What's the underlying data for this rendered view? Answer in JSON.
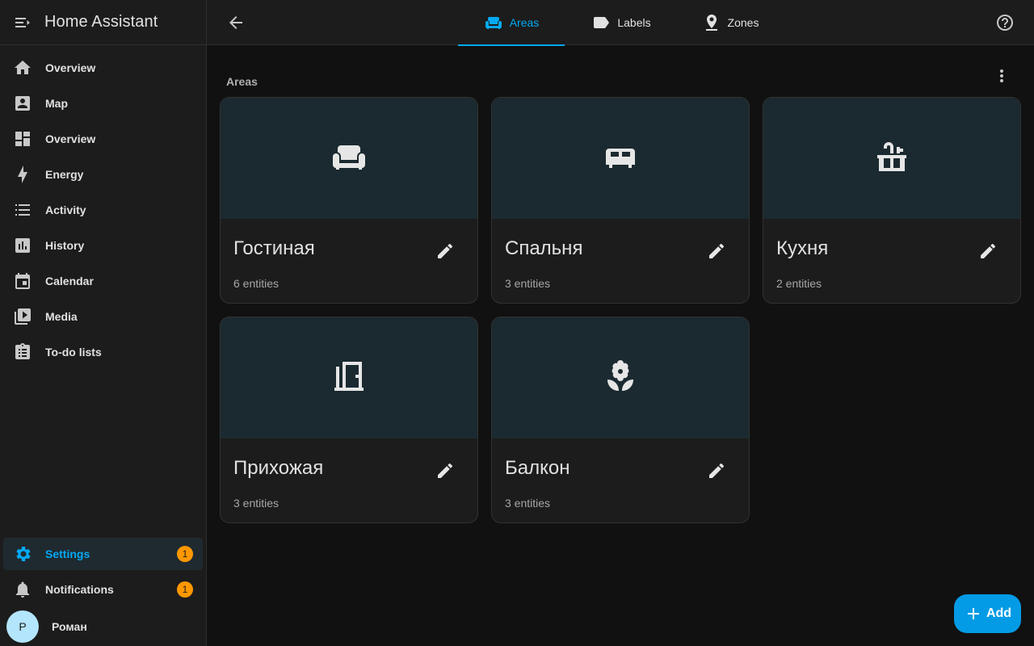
{
  "app": {
    "title": "Home Assistant"
  },
  "sidebar": {
    "items": [
      {
        "label": "Overview",
        "icon": "home-icon"
      },
      {
        "label": "Map",
        "icon": "map-icon"
      },
      {
        "label": "Overview",
        "icon": "dashboard-icon"
      },
      {
        "label": "Energy",
        "icon": "energy-icon"
      },
      {
        "label": "Activity",
        "icon": "activity-icon"
      },
      {
        "label": "History",
        "icon": "history-icon"
      },
      {
        "label": "Calendar",
        "icon": "calendar-icon"
      },
      {
        "label": "Media",
        "icon": "media-icon"
      },
      {
        "label": "To-do lists",
        "icon": "todo-icon"
      }
    ],
    "settings": {
      "label": "Settings",
      "badge": "1"
    },
    "notifications": {
      "label": "Notifications",
      "badge": "1"
    },
    "user": {
      "initial": "Р",
      "name": "Роман"
    }
  },
  "topbar": {
    "tabs": [
      {
        "label": "Areas",
        "icon": "sofa-icon",
        "active": true
      },
      {
        "label": "Labels",
        "icon": "label-icon",
        "active": false
      },
      {
        "label": "Zones",
        "icon": "map-marker-icon",
        "active": false
      }
    ]
  },
  "main": {
    "section_title": "Areas",
    "areas": [
      {
        "name": "Гостиная",
        "entities": "6 entities",
        "icon": "sofa-icon"
      },
      {
        "name": "Спальня",
        "entities": "3 entities",
        "icon": "bed-icon"
      },
      {
        "name": "Кухня",
        "entities": "2 entities",
        "icon": "sink-icon"
      },
      {
        "name": "Прихожая",
        "entities": "3 entities",
        "icon": "door-icon"
      },
      {
        "name": "Балкон",
        "entities": "3 entities",
        "icon": "flower-icon"
      }
    ],
    "add_label": "Add"
  },
  "colors": {
    "accent": "#03a9f4",
    "badge": "#ff9800",
    "fab": "#039be5",
    "card_picture": "#1b2a30",
    "background": "#111111",
    "surface": "#1c1c1c"
  }
}
